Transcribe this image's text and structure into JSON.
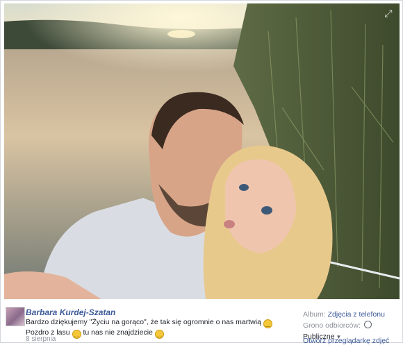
{
  "post": {
    "author": "Barbara Kurdej-Szatan",
    "caption_a": "Bardzo dziękujemy \"Życiu na gorąco\", że tak się ogromnie o nas martwią",
    "caption_b": "Pozdro z lasu",
    "caption_c": "tu nas nie znajdziecie",
    "date": "8 sierpnia"
  },
  "meta": {
    "album_label": "Album:",
    "album_value": "Zdjęcia z telefonu",
    "audience_label": "Grono odbiorców:",
    "audience_value": "Publiczne",
    "open_viewer": "Otwórz przeglądarkę zdjęć"
  },
  "icons": {
    "expand": "expand-icon",
    "smile": "smile-emoji",
    "globe": "globe-icon",
    "dropdown": "chevron-down-icon"
  },
  "colors": {
    "link": "#3b5998",
    "muted": "#90949c",
    "text": "#1d2129"
  }
}
